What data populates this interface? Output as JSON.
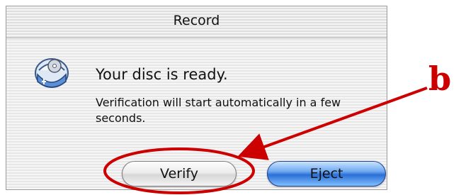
{
  "window": {
    "title": "Record"
  },
  "icon": {
    "name": "disc-tray-icon"
  },
  "message": {
    "heading": "Your disc is ready.",
    "body": "Verification will start automatically in a few seconds."
  },
  "buttons": {
    "verify_label": "Verify",
    "eject_label": "Eject"
  },
  "annotation": {
    "label": "b",
    "color": "#cc0000"
  }
}
